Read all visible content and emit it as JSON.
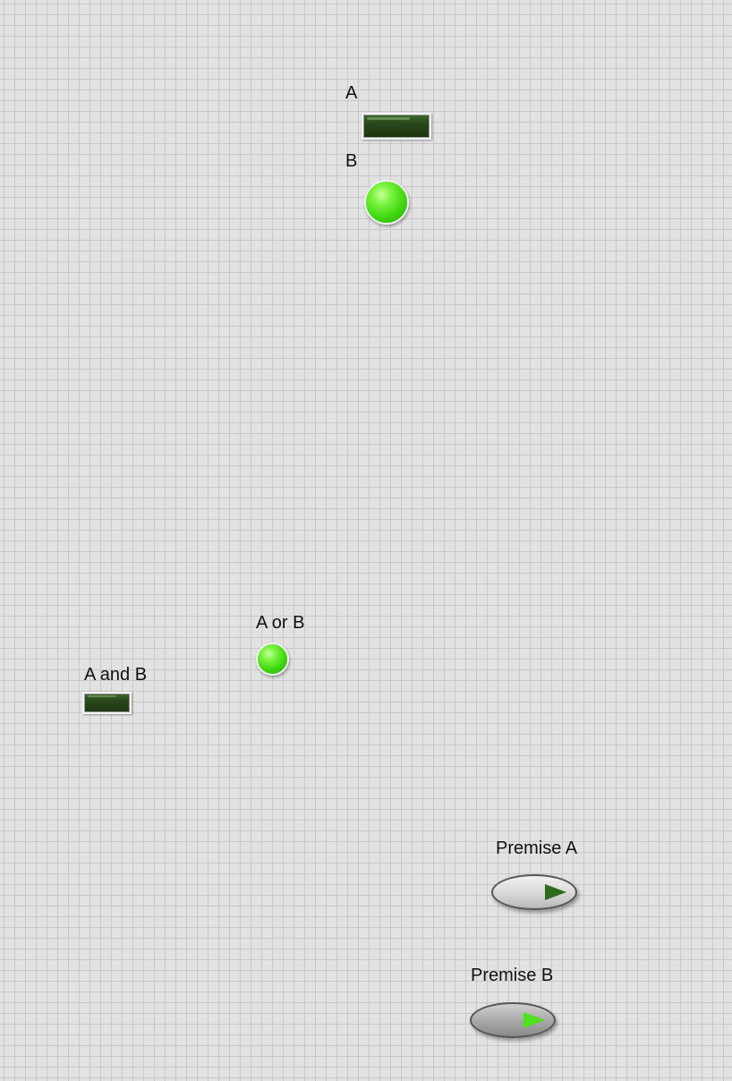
{
  "front_panel": {
    "indicator_a": {
      "label": "A",
      "state": "off",
      "color_off": "#2a4a1c"
    },
    "indicator_b": {
      "label": "B",
      "state": "on",
      "color_on": "#4fe01f"
    },
    "indicator_a_or_b": {
      "label": "A or B",
      "state": "on",
      "color_on": "#4fe01f"
    },
    "indicator_a_and_b": {
      "label": "A and B",
      "state": "off",
      "color_off": "#2a4a1c"
    },
    "premise_a": {
      "label": "Premise A",
      "state": "off",
      "icon": "play-arrow-icon"
    },
    "premise_b": {
      "label": "Premise B",
      "state": "on",
      "icon": "play-arrow-icon"
    }
  }
}
